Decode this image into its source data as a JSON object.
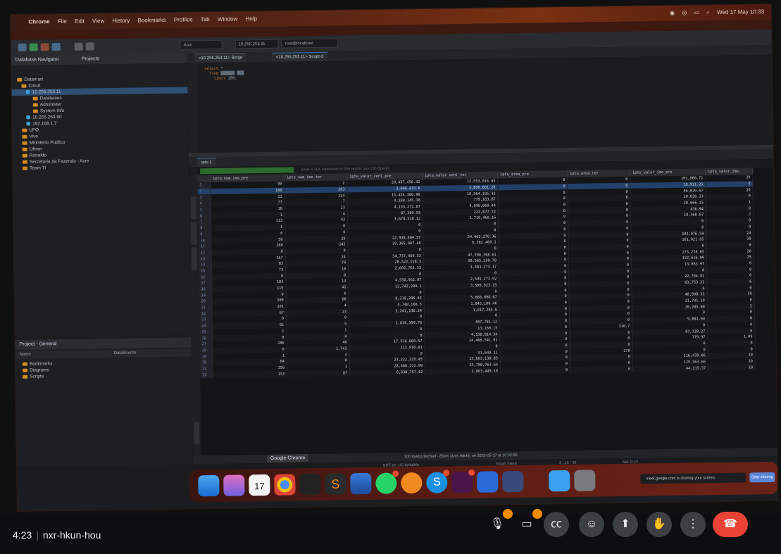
{
  "menubar": {
    "app": "Chrome",
    "items": [
      "File",
      "Edit",
      "View",
      "History",
      "Bookmarks",
      "Profiles",
      "Tab",
      "Window",
      "Help"
    ],
    "clock": "Wed 17 May 10:33"
  },
  "toolbar": {
    "auto_label": "Auto",
    "connection": "10.255.253.11",
    "user": "root@localhost"
  },
  "nav": {
    "title": "Database Navigator",
    "tab2": "Projects",
    "tree": [
      "Datamart",
      "Cloud",
      "10.255.253.11",
      "Databases",
      "Administer",
      "System Info",
      "10.255.253.90",
      "192.168.1.7",
      "UFO",
      "Vivo",
      "Ministerio Publico",
      "Ufrran",
      "Ronaldo",
      "Secretaria da Fazenda - Acre",
      "Team TI"
    ]
  },
  "project": {
    "title": "Project - General",
    "col_name": "Name",
    "col_datasource": "DataSource",
    "items": [
      "Bookmarks",
      "Diagrams",
      "Scripts"
    ]
  },
  "editor": {
    "tab1": "<10.255.253.11> Script",
    "tab2": "<10.255.253.11> Script-3"
  },
  "results": {
    "tab": "iptu 1",
    "filter_placeholder": "Enter a SQL expression to filter results (use Ctrl+Space)"
  },
  "table": {
    "columns": [
      "iptu_num_imo_pre",
      "iptu_num_imo_ter",
      "iptu_valor_venl_pre",
      "iptu_valor_venl_ter",
      "iptu_area_pre",
      "iptu_area_ter",
      "iptu_valor_imo_pre",
      "iptu_valor_imo_"
    ],
    "rows": [
      [
        "99",
        "2",
        "20,437,456.42",
        "12,553,016.45",
        "0",
        "0",
        "101,088.71",
        "29"
      ],
      [
        "106",
        "283",
        "3,406,415.6",
        "3,600,601.28",
        "0",
        "0",
        "18,911.25",
        "4"
      ],
      [
        "21",
        "124",
        "15,434,300.98",
        "10,564,195.33",
        "0",
        "0",
        "86,029.67",
        "20"
      ],
      [
        "77",
        "7",
        "4,180,145.38",
        "779,163.87",
        "0",
        "0",
        "20,026.13",
        "0"
      ],
      [
        "18",
        "23",
        "4,133,271.07",
        "4,090,069.44",
        "0",
        "0",
        "20,666.15",
        "1"
      ],
      [
        "1",
        "4",
        "87,389.93",
        "223,677.72",
        "0",
        "0",
        "436.94",
        "0"
      ],
      [
        "113",
        "42",
        "3,674,518.12",
        "1,710,460.16",
        "0",
        "0",
        "18,368.07",
        "2"
      ],
      [
        "1",
        "0",
        "0",
        "0",
        "0",
        "0",
        "0",
        "0"
      ],
      [
        "0",
        "0",
        "0",
        "0",
        "0",
        "0",
        "0",
        "0"
      ],
      [
        "56",
        "28",
        "22,938,404.57",
        "24,462,276.36",
        "0",
        "0",
        "102,076.59",
        "24"
      ],
      [
        "260",
        "142",
        "20,365,007.40",
        "6,582,468.1",
        "0",
        "0",
        "101,021.85",
        "10"
      ],
      [
        "0",
        "0",
        "0",
        "0",
        "0",
        "0",
        "0",
        "0"
      ],
      [
        "367",
        "24",
        "54,737,469.53",
        "47,700,368.61",
        "0",
        "0",
        "273,278.65",
        "20"
      ],
      [
        "83",
        "79",
        "28,522,118.3",
        "58,565,238.78",
        "0",
        "0",
        "132,616.09",
        "29"
      ],
      [
        "73",
        "18",
        "2,602,761.53",
        "1,483,273.17",
        "0",
        "0",
        "13,083.97",
        "0"
      ],
      [
        "0",
        "0",
        "0",
        "0",
        "0",
        "0",
        "0",
        "0"
      ],
      [
        "103",
        "14",
        "4,556,962.07",
        "2,545,273.92",
        "0",
        "0",
        "22,784.81",
        "0"
      ],
      [
        "115",
        "42",
        "12,742,209.1",
        "3,500,623.15",
        "0",
        "0",
        "63,753.21",
        "6"
      ],
      [
        "0",
        "0",
        "0",
        "0",
        "0",
        "0",
        "0",
        "0"
      ],
      [
        "100",
        "60",
        "8,219,286.43",
        "5,660,098.67",
        "0",
        "0",
        "40,998.31",
        "10"
      ],
      [
        "101",
        "4",
        "4,740,168.5",
        "1,643,108.46",
        "0",
        "0",
        "21,701.18",
        "0"
      ],
      [
        "67",
        "23",
        "5,241,136.24",
        "1,617,284.6",
        "0",
        "0",
        "26,205.68",
        "3"
      ],
      [
        "0",
        "0",
        "0",
        "0",
        "0",
        "0",
        "0",
        "0"
      ],
      [
        "61",
        "5",
        "1,836,359.76",
        "467,781.12",
        "0",
        "0",
        "9,881.64",
        "0"
      ],
      [
        "1",
        "1",
        "0",
        "13,180.15",
        "0",
        "310.7",
        "0",
        "0"
      ],
      [
        "0",
        "0",
        "0",
        "4,150,814.34",
        "0",
        "0",
        "87,728.27",
        "6"
      ],
      [
        "286",
        "46",
        "17,936,868.57",
        "24,466,541.81",
        "0",
        "0",
        "779.97",
        "1.09"
      ],
      [
        "0",
        "1,742",
        "113,916.01",
        "0",
        "0",
        "0",
        "0",
        "0"
      ],
      [
        "1",
        "4",
        "0",
        "53,649.11",
        "0",
        "270",
        "0",
        "0"
      ],
      [
        "84",
        "0",
        "23,222,235.45",
        "15,603,138.83",
        "0",
        "0",
        "116,439.06",
        "10"
      ],
      [
        "356",
        "3",
        "28,408,172.99",
        "23,780,763.64",
        "0",
        "0",
        "129,563.66",
        "10"
      ],
      [
        "153",
        "87",
        "8,838,757.42",
        "2,803,449.18",
        "0",
        "0",
        "44,115.37",
        "10"
      ]
    ]
  },
  "status": {
    "fetched": "100 row(s) fetched - 85ms (1ms fetch), on 2023-05-17 at 10:32:56",
    "tooltip": "Google Chrome",
    "encoding": "BRT  en_US  Writable",
    "mode": "Smart Insert",
    "position": "3 : 15 : 42",
    "sel": "Sel: 0 | 0"
  },
  "dock": {
    "calendar_day": "17",
    "share_text": "meet.google.com is sharing your screen.",
    "stop_label": "Stop sharing"
  },
  "meet": {
    "time": "4:23",
    "code": "nxr-hkun-hou"
  },
  "colors": {
    "accent": "#3c6fb0",
    "endcall": "#ea4335",
    "badge": "#f28b00"
  }
}
